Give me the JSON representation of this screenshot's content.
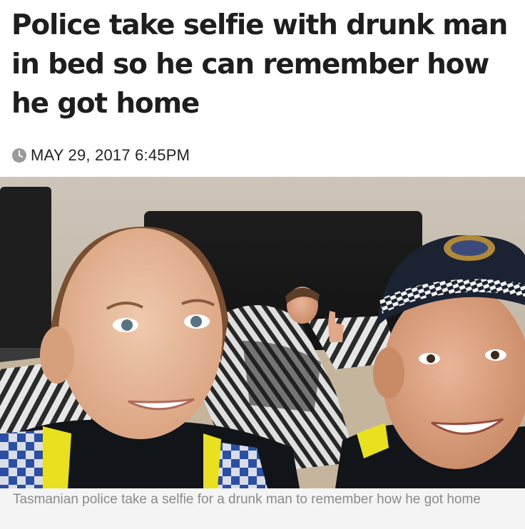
{
  "article": {
    "headline": "Police take selfie with drunk man in bed so he can remember how he got home",
    "date": "MAY 29, 2017 6:45PM",
    "date_icon": "clock-icon",
    "caption": "Tasmanian police take a selfie for a drunk man to remember how he got home"
  },
  "photo": {
    "alt": "Tasmanian police take a selfie for a drunk man to remember how he got home"
  },
  "colors": {
    "headline": "#1e1e1e",
    "caption_bg": "#f4f4f4",
    "caption_text": "#8a8a8a",
    "police_cap": "#1b2333",
    "hi_vis": "#e9e01f"
  }
}
